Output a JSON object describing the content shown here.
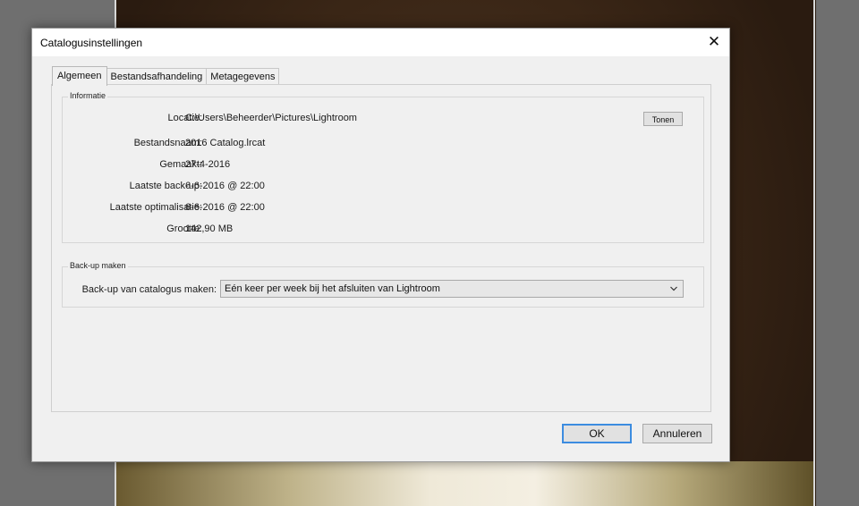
{
  "window": {
    "title": "Catalogusinstellingen",
    "close_glyph": "✕"
  },
  "tabs": [
    {
      "label": "Algemeen",
      "active": true
    },
    {
      "label": "Bestandsafhandeling",
      "active": false
    },
    {
      "label": "Metagegevens",
      "active": false
    }
  ],
  "info": {
    "group_label": "Informatie",
    "rows": [
      {
        "label": "Locatie:",
        "value": "C:\\Users\\Beheerder\\Pictures\\Lightroom"
      },
      {
        "label": "Bestandsnaam:",
        "value": "2016 Catalog.lrcat"
      },
      {
        "label": "Gemaakt:",
        "value": "27-4-2016"
      },
      {
        "label": "Laatste back-up:",
        "value": "6-6-2016 @ 22:00"
      },
      {
        "label": "Laatste optimalisatie:",
        "value": "6-6-2016 @ 22:00"
      },
      {
        "label": "Grootte:",
        "value": "142,90 MB"
      }
    ],
    "show_button": "Tonen"
  },
  "backup": {
    "group_label": "Back-up maken",
    "label": "Back-up van catalogus maken:",
    "selected": "Eén keer per week bij het afsluiten van Lightroom"
  },
  "buttons": {
    "ok": "OK",
    "cancel": "Annuleren"
  },
  "colors": {
    "accent": "#3c8ce0",
    "dialog_bg": "#f0f0f0"
  },
  "icons": {
    "close": "close-icon",
    "dropdown": "chevron-down-icon"
  }
}
